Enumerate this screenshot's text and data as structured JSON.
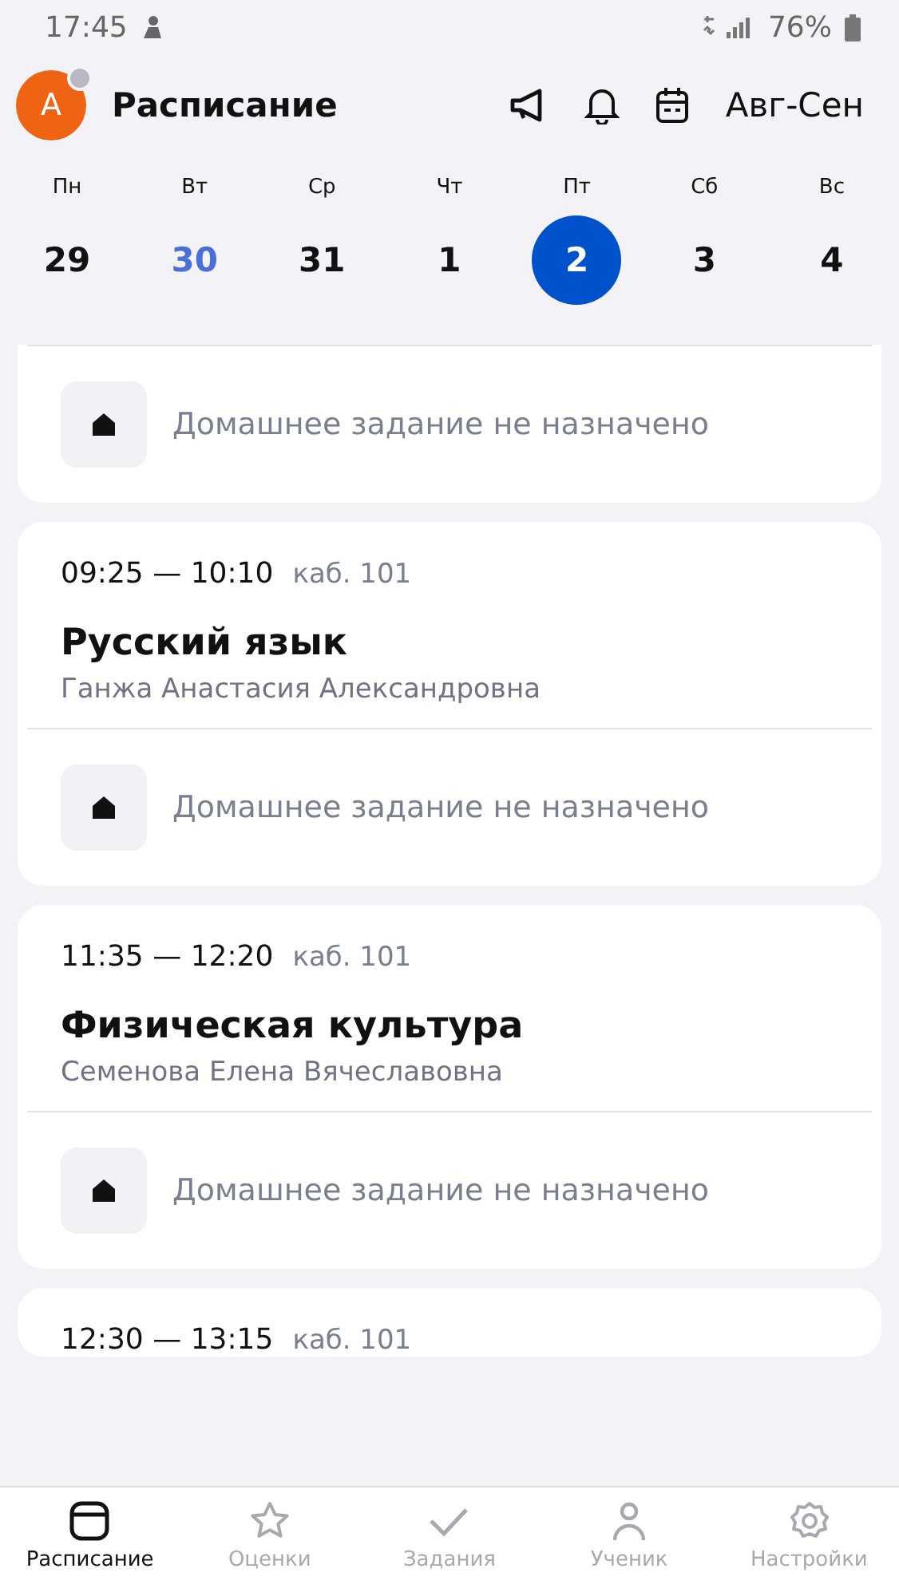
{
  "status_bar": {
    "time": "17:45",
    "battery": "76%"
  },
  "header": {
    "avatar_letter": "А",
    "title": "Расписание",
    "period": "Авг-Сен"
  },
  "week": [
    {
      "day": "Пн",
      "date": "29",
      "today": false,
      "selected": false
    },
    {
      "day": "Вт",
      "date": "30",
      "today": true,
      "selected": false
    },
    {
      "day": "Ср",
      "date": "31",
      "today": false,
      "selected": false
    },
    {
      "day": "Чт",
      "date": "1",
      "today": false,
      "selected": false
    },
    {
      "day": "Пт",
      "date": "2",
      "today": false,
      "selected": true
    },
    {
      "day": "Сб",
      "date": "3",
      "today": false,
      "selected": false
    },
    {
      "day": "Вс",
      "date": "4",
      "today": false,
      "selected": false
    }
  ],
  "lessons": [
    {
      "homework": "Домашнее задание не назначено"
    },
    {
      "time": "09:25 — 10:10",
      "room": "каб. 101",
      "subject": "Русский язык",
      "teacher": "Ганжа Анастасия Александровна",
      "homework": "Домашнее задание не назначено"
    },
    {
      "time": "11:35 — 12:20",
      "room": "каб. 101",
      "subject": "Физическая культура",
      "teacher": "Семенова Елена Вячеславовна",
      "homework": "Домашнее задание не назначено"
    },
    {
      "time": "12:30 — 13:15",
      "room": "каб. 101"
    }
  ],
  "bottom_nav": [
    {
      "kind": "schedule",
      "label": "Расписание",
      "selected": true
    },
    {
      "kind": "grades",
      "label": "Оценки",
      "selected": false
    },
    {
      "kind": "tasks",
      "label": "Задания",
      "selected": false
    },
    {
      "kind": "student",
      "label": "Ученик",
      "selected": false
    },
    {
      "kind": "settings",
      "label": "Настройки",
      "selected": false
    }
  ]
}
